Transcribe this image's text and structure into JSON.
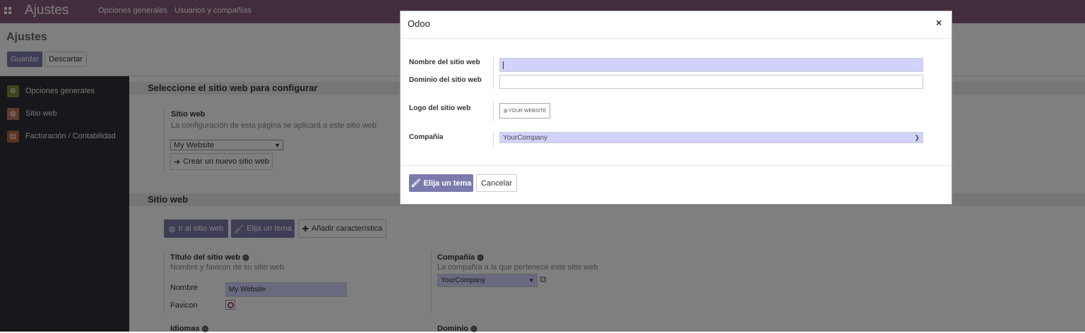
{
  "navbar": {
    "app_title": "Ajustes",
    "links": [
      "Opciones generales",
      "Usuarios y compañías"
    ]
  },
  "control_panel": {
    "title": "Ajustes",
    "save_label": "Guardar",
    "discard_label": "Descartar"
  },
  "sidebar": {
    "items": [
      {
        "label": "Opciones generales",
        "icon": "gear-icon",
        "color": "#7a8a3a"
      },
      {
        "label": "Sitio web",
        "icon": "globe-icon",
        "color": "#c0765a"
      },
      {
        "label": "Facturación / Contabilidad",
        "icon": "invoice-icon",
        "color": "#b8653c"
      }
    ]
  },
  "website_select": {
    "header": "Seleccione el sitio web para configurar",
    "title": "Sitio web",
    "help": "La configuración de esta página se aplicará a este sitio web",
    "selected": "My Website",
    "create_label": "Crear un nuevo sitio web"
  },
  "website_section": {
    "header": "Sitio web",
    "go_label": "Ir al sitio web",
    "theme_label": "Elija un tema",
    "add_feature_label": "Añadir característica",
    "title_setting": {
      "title": "Título del sitio web",
      "help": "Nombre y favicon de su sitio web",
      "name_label": "Nombre",
      "name_value": "My Website",
      "favicon_label": "Favicon"
    },
    "company_setting": {
      "title": "Compañía",
      "help": "La compañía a la que pertenece este sitio web",
      "value": "YourCompany"
    },
    "languages_title": "Idiomas",
    "domain_title": "Dominio"
  },
  "modal": {
    "title": "Odoo",
    "close_symbol": "×",
    "fields": {
      "name_label": "Nombre del sitio web",
      "name_value": "",
      "domain_label": "Dominio del sitio web",
      "domain_value": "",
      "logo_label": "Logo del sitio web",
      "logo_text": "YOUR WEBSITE",
      "company_label": "Compañía",
      "company_value": "YourCompany"
    },
    "choose_theme_label": "Elija un tema",
    "cancel_label": "Cancelar"
  },
  "colors": {
    "brand": "#875a7b",
    "primary": "#7c7bad",
    "highlight": "#d2d2ff",
    "sidebar": "#2f3136"
  }
}
